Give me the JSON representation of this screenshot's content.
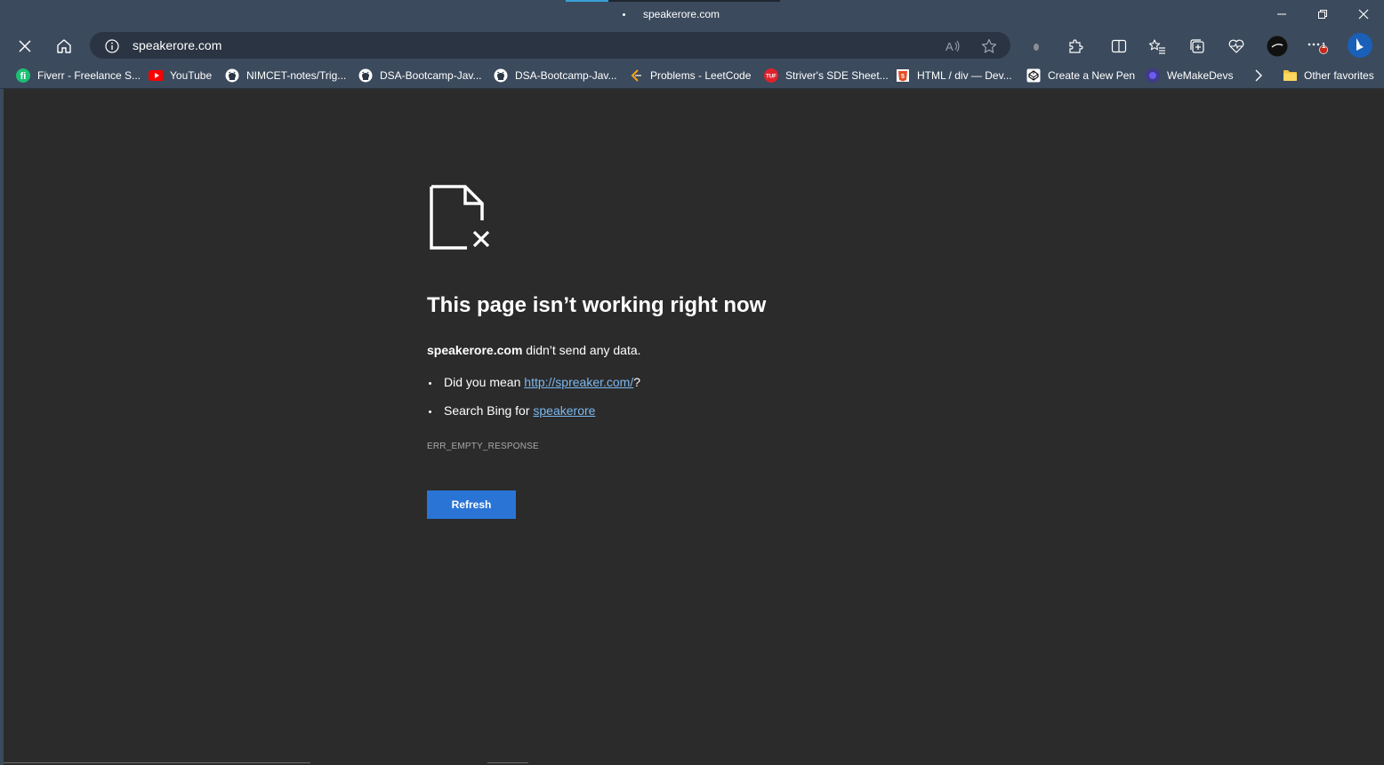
{
  "window": {
    "title": "speakerore.com",
    "minimize_icon": "minimize-icon",
    "restore_icon": "restore-icon",
    "close_icon": "close-icon"
  },
  "nav": {
    "address": "speakerore.com",
    "stop_icon": "close-icon",
    "home_icon": "home-icon",
    "site_info_icon": "info-icon",
    "notification_badge": "1"
  },
  "favorites": {
    "items": [
      {
        "label": "Fiverr - Freelance S...",
        "icon": "fiverr-icon",
        "color": "#1dbf73"
      },
      {
        "label": "YouTube",
        "icon": "youtube-icon",
        "color": "#ff0000"
      },
      {
        "label": "NIMCET-notes/Trig...",
        "icon": "github-icon",
        "color": "#ffffff"
      },
      {
        "label": "DSA-Bootcamp-Jav...",
        "icon": "github-icon",
        "color": "#ffffff"
      },
      {
        "label": "DSA-Bootcamp-Jav...",
        "icon": "github-icon",
        "color": "#ffffff"
      },
      {
        "label": "Problems - LeetCode",
        "icon": "leetcode-icon",
        "color": "#ffa116"
      },
      {
        "label": "Striver's SDE Sheet...",
        "icon": "tuf-icon",
        "color": "#e0212b"
      },
      {
        "label": "HTML / div — Dev...",
        "icon": "html5-icon",
        "color": "#e44d26"
      },
      {
        "label": "Create a New Pen",
        "icon": "codepen-icon",
        "color": "#ffffff"
      },
      {
        "label": "WeMakeDevs",
        "icon": "wemakedevs-icon",
        "color": "#5b4bdb"
      }
    ],
    "more_icon": "chevron-right-icon",
    "other_favorites": "Other favorites"
  },
  "error": {
    "icon": "broken-file-icon",
    "heading": "This page isn’t working right now",
    "host": "speakerore.com",
    "message": "didn’t send any data.",
    "suggestion1_prefix": "Did you mean",
    "suggestion1_link": "http://spreaker.com/",
    "suggestion1_suffix": "?",
    "suggestion2_prefix": "Search Bing for",
    "suggestion2_link": "speakerore",
    "code": "ERR_EMPTY_RESPONSE",
    "button": "Refresh"
  },
  "colors": {
    "chrome": "#3b4a5c",
    "content_bg": "#2b2b2b",
    "link": "#7cb8f0",
    "button": "#2a74d6"
  }
}
